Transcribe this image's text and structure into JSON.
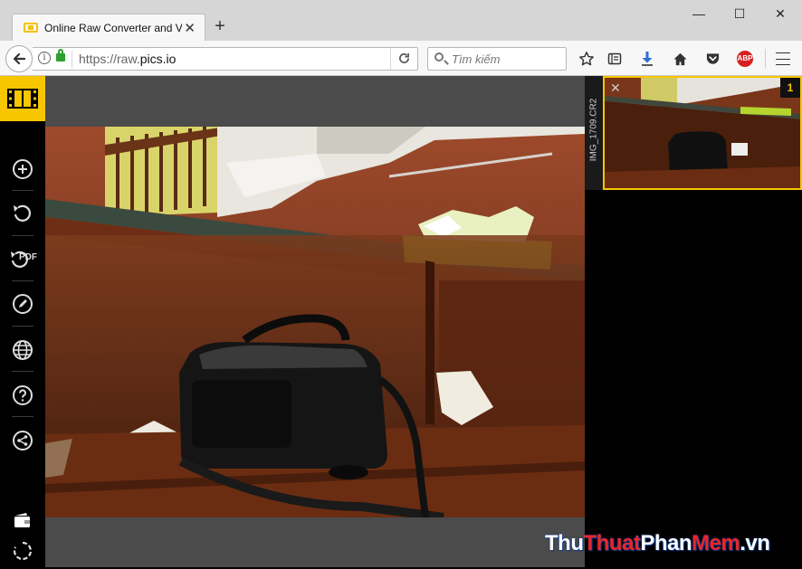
{
  "browser": {
    "tab": {
      "title": "Online Raw Converter and V",
      "close_glyph": "✕"
    },
    "new_tab_glyph": "+",
    "window": {
      "minimize": "—",
      "maximize": "☐",
      "close": "✕"
    },
    "url": {
      "prefix": "https://raw.",
      "domain": "pics.io"
    },
    "search": {
      "placeholder": "Tìm kiếm"
    },
    "abp_label": "ABP"
  },
  "sidebar": {
    "items": [
      {
        "name": "add-icon"
      },
      {
        "name": "rotate-icon"
      },
      {
        "name": "pdf-export-icon",
        "label": "PDF"
      },
      {
        "name": "edit-icon"
      },
      {
        "name": "globe-icon"
      },
      {
        "name": "help-icon"
      },
      {
        "name": "share-icon"
      }
    ]
  },
  "filmstrip": {
    "file_name": "IMG_1709.CR2",
    "index": "1",
    "close_glyph": "✕"
  },
  "watermark": {
    "part1": "Thu",
    "part2": "Thuat",
    "part3": "Phan",
    "part4": "Mem",
    "part5": ".vn"
  },
  "colors": {
    "accent": "#f7c600",
    "stage": "#4b4b4b",
    "sidebar": "#000000"
  }
}
